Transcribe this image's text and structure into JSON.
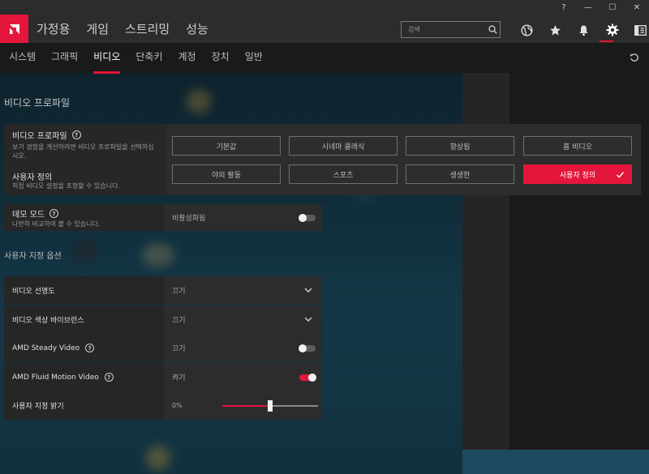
{
  "window": {
    "controls": [
      "?",
      "—",
      "☐",
      "✕"
    ]
  },
  "nav": {
    "tabs": [
      "가정용",
      "게임",
      "스트리밍",
      "성능"
    ]
  },
  "search": {
    "placeholder": "검색"
  },
  "topicons": [
    "globe-icon",
    "star-icon",
    "bell-icon",
    "gear-icon",
    "sidebar-icon"
  ],
  "subnav": {
    "tabs": [
      "시스템",
      "그래픽",
      "비디오",
      "단축키",
      "계정",
      "장치",
      "일반"
    ],
    "active": "비디오"
  },
  "video_profile_section": {
    "title": "비디오 프로파일"
  },
  "profile_card": {
    "title": "비디오 프로파일",
    "description": "보기 경험을 개선하려면 비디오 프로파일을 선택하십시오.",
    "custom_title": "사용자 정의",
    "custom_description": "직접 비디오 설정을 조정할 수 있습니다.",
    "buttons": [
      "기본값",
      "시네마 클래식",
      "향상됨",
      "홈 비디오",
      "야외 활동",
      "스포츠",
      "생생한",
      "사용자 정의"
    ],
    "selected": "사용자 정의"
  },
  "demo_mode": {
    "title": "데모 모드",
    "description": "나란히 비교하여 볼 수 있습니다.",
    "value": "비활성화됨",
    "enabled": false
  },
  "custom_options": {
    "title": "사용자 지정 옵션",
    "rows": [
      {
        "label": "비디오 선명도",
        "value": "끄기",
        "control": "dropdown"
      },
      {
        "label": "비디오 색상 바이브런스",
        "value": "끄기",
        "control": "dropdown"
      },
      {
        "label": "AMD Steady Video",
        "value": "끄기",
        "control": "toggle",
        "enabled": false,
        "help": true
      },
      {
        "label": "AMD Fluid Motion Video",
        "value": "켜기",
        "control": "toggle",
        "enabled": true,
        "help": true
      },
      {
        "label": "사용자 지정 밝기",
        "value": "0%",
        "control": "slider",
        "level_percent": 50
      }
    ]
  },
  "colors": {
    "accent": "#e4163b",
    "card": "#2a2a2a",
    "topbar": "#2c2c2c"
  }
}
